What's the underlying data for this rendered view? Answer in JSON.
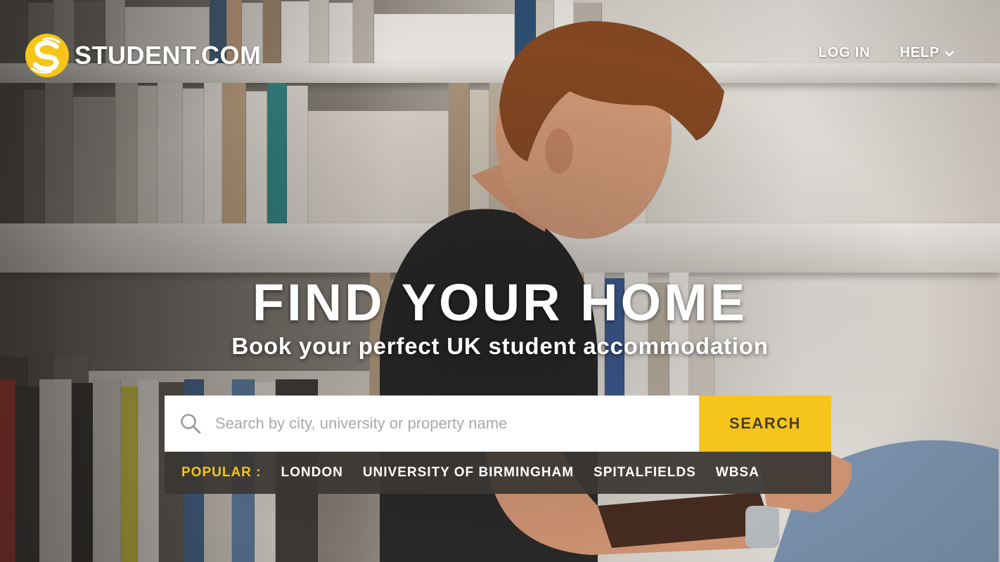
{
  "brand": {
    "name": "STUDENT.COM",
    "logo_icon": "student-s-logo",
    "accent_color": "#f5c51b"
  },
  "nav": {
    "login_label": "LOG IN",
    "help_label": "HELP",
    "help_icon": "chevron-down-icon"
  },
  "hero": {
    "title": "FIND YOUR HOME",
    "subtitle": "Book your perfect UK student accommodation"
  },
  "search": {
    "icon": "search-icon",
    "placeholder": "Search by city, university or property name",
    "value": "",
    "button_label": "SEARCH"
  },
  "popular": {
    "label": "POPULAR :",
    "items": [
      {
        "label": "LONDON"
      },
      {
        "label": "UNIVERSITY OF BIRMINGHAM"
      },
      {
        "label": "SPITALFIELDS"
      },
      {
        "label": "WBSA"
      }
    ]
  }
}
